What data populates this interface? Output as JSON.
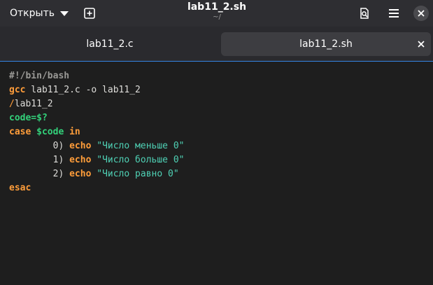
{
  "header": {
    "open_label": "Открыть",
    "title": "lab11_2.sh",
    "subtitle": "~/"
  },
  "tabs": [
    {
      "label": "lab11_2.c",
      "active": false
    },
    {
      "label": "lab11_2.sh",
      "active": true
    }
  ],
  "code": {
    "shebang": "#!/bin/bash",
    "line2_kw": "gcc",
    "line2_rest": " lab11_2.c -o lab11_2",
    "line3_slash": "/",
    "line3_rest": "lab11_2",
    "line4_var": "code=$?",
    "line5_kw": "case",
    "line5_var": "$code",
    "line5_in": "in",
    "case0_label": "0)",
    "case1_label": "1)",
    "case2_label": "2)",
    "echo_kw": "echo",
    "case0_str": "\"Число меньше 0\"",
    "case1_str": "\"Число больше 0\"",
    "case2_str": "\"Число равно 0\"",
    "esac": "esac"
  },
  "colors": {
    "accent": "#3584e4",
    "keyword": "#ff9d3a",
    "variable": "#33d17a",
    "string": "#4fd1b5"
  }
}
